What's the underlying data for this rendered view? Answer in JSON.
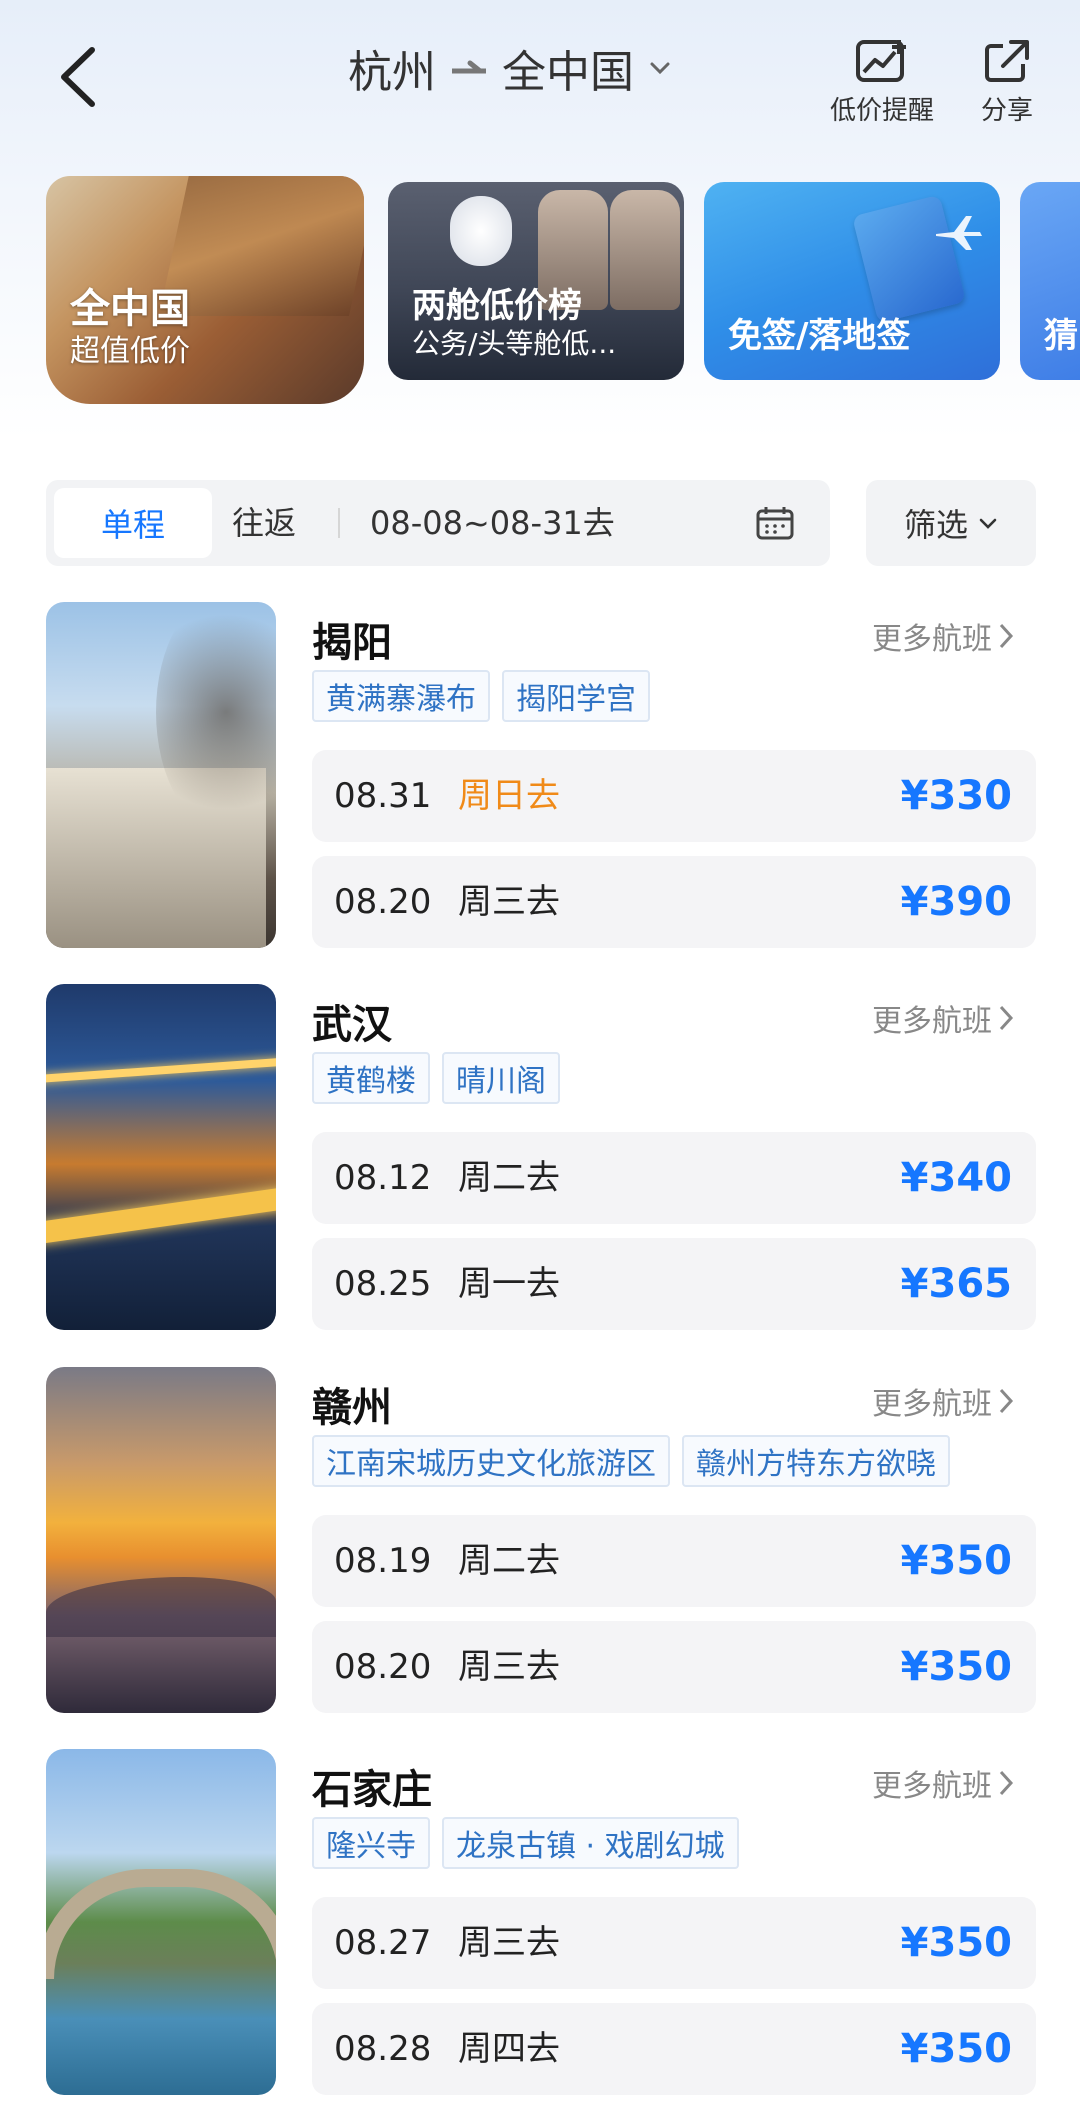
{
  "header": {
    "origin": "杭州",
    "destination": "全中国",
    "alert_label": "低价提醒",
    "share_label": "分享"
  },
  "banners": [
    {
      "title": "全中国",
      "subtitle": "超值低价"
    },
    {
      "title": "两舱低价榜",
      "subtitle": "公务/头等舱低..."
    },
    {
      "title": "免签/落地签",
      "subtitle": ""
    },
    {
      "title": "猜",
      "subtitle": ""
    }
  ],
  "filters": {
    "one_way": "单程",
    "round_trip": "往返",
    "date_range": "08-08~08-31去",
    "filter_label": "筛选"
  },
  "destinations": [
    {
      "city": "揭阳",
      "more": "更多航班",
      "tags": [
        "黄满寨瀑布",
        "揭阳学宫"
      ],
      "flights": [
        {
          "date": "08.31",
          "weekday": "周日去",
          "price": "¥330"
        },
        {
          "date": "08.20",
          "weekday": "周三去",
          "price": "¥390"
        }
      ]
    },
    {
      "city": "武汉",
      "more": "更多航班",
      "tags": [
        "黄鹤楼",
        "晴川阁"
      ],
      "flights": [
        {
          "date": "08.12",
          "weekday": "周二去",
          "price": "¥340"
        },
        {
          "date": "08.25",
          "weekday": "周一去",
          "price": "¥365"
        }
      ]
    },
    {
      "city": "赣州",
      "more": "更多航班",
      "tags": [
        "江南宋城历史文化旅游区",
        "赣州方特东方欲晓"
      ],
      "flights": [
        {
          "date": "08.19",
          "weekday": "周二去",
          "price": "¥350"
        },
        {
          "date": "08.20",
          "weekday": "周三去",
          "price": "¥350"
        }
      ]
    },
    {
      "city": "石家庄",
      "more": "更多航班",
      "tags": [
        "隆兴寺",
        "龙泉古镇 · 戏剧幻城"
      ],
      "flights": [
        {
          "date": "08.27",
          "weekday": "周三去",
          "price": "¥350"
        },
        {
          "date": "08.28",
          "weekday": "周四去",
          "price": "¥350"
        }
      ]
    }
  ],
  "colors": {
    "accent": "#1677ff",
    "highlight_weekday": "#f08a18",
    "tag_text": "#2f73c4"
  }
}
